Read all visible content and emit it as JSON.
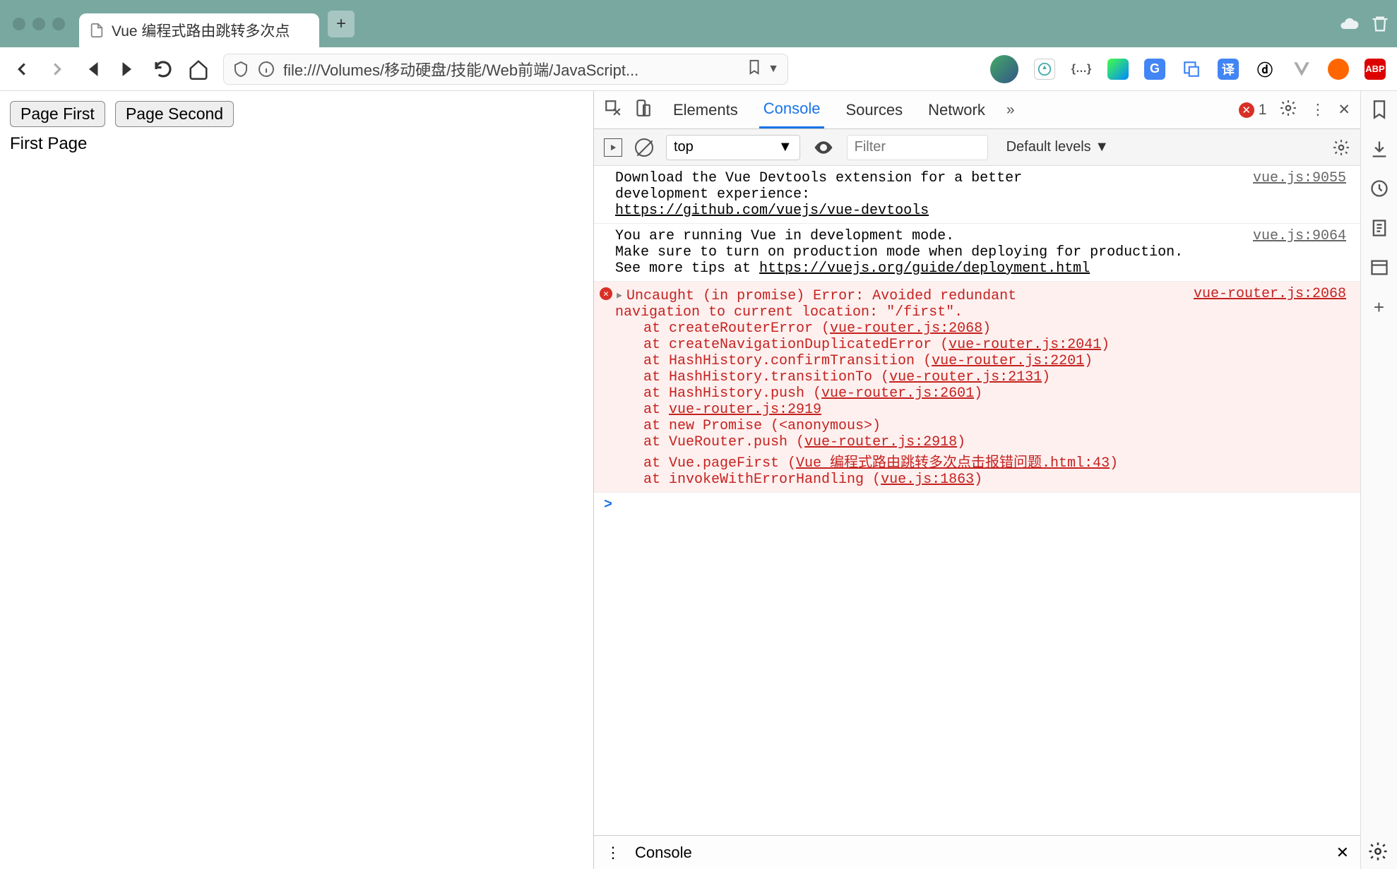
{
  "browser": {
    "tab_title": "Vue 编程式路由跳转多次点",
    "url": "file:///Volumes/移动硬盘/技能/Web前端/JavaScript..."
  },
  "page": {
    "btn_first": "Page First",
    "btn_second": "Page Second",
    "heading": "First Page"
  },
  "devtools": {
    "tabs": {
      "elements": "Elements",
      "console": "Console",
      "sources": "Sources",
      "network": "Network"
    },
    "error_count": "1",
    "toolbar": {
      "context": "top",
      "filter_placeholder": "Filter",
      "levels": "Default levels ▼"
    },
    "logs": {
      "msg1_line1": "Download the Vue Devtools extension for a better",
      "msg1_line2": "development experience:",
      "msg1_link": "https://github.com/vuejs/vue-devtools",
      "msg1_src": "vue.js:9055",
      "msg2_line1": "You are running Vue in development mode.",
      "msg2_line2": "Make sure to turn on production mode when deploying for production.",
      "msg2_line3a": "See more tips at ",
      "msg2_link": "https://vuejs.org/guide/deployment.html",
      "msg2_src": "vue.js:9064",
      "err_src": "vue-router.js:2068",
      "err_head1": "Uncaught (in promise) Error: Avoided redundant",
      "err_head2": "navigation to current location: \"/first\".",
      "st1_a": "at createRouterError (",
      "st1_l": "vue-router.js:2068",
      "st1_b": ")",
      "st2_a": "at createNavigationDuplicatedError (",
      "st2_l": "vue-router.js:2041",
      "st2_b": ")",
      "st3_a": "at HashHistory.confirmTransition (",
      "st3_l": "vue-router.js:2201",
      "st3_b": ")",
      "st4_a": "at HashHistory.transitionTo (",
      "st4_l": "vue-router.js:2131",
      "st4_b": ")",
      "st5_a": "at HashHistory.push (",
      "st5_l": "vue-router.js:2601",
      "st5_b": ")",
      "st6_a": "at ",
      "st6_l": "vue-router.js:2919",
      "st7": "at new Promise (<anonymous>)",
      "st8_a": "at VueRouter.push (",
      "st8_l": "vue-router.js:2918",
      "st8_b": ")",
      "st9_a": "at Vue.pageFirst (",
      "st9_l": "Vue 编程式路由跳转多次点击报错问题.html:43",
      "st9_b": ")",
      "st10_a": "at invokeWithErrorHandling (",
      "st10_l": "vue.js:1863",
      "st10_b": ")"
    },
    "drawer_label": "Console",
    "prompt": ">"
  }
}
